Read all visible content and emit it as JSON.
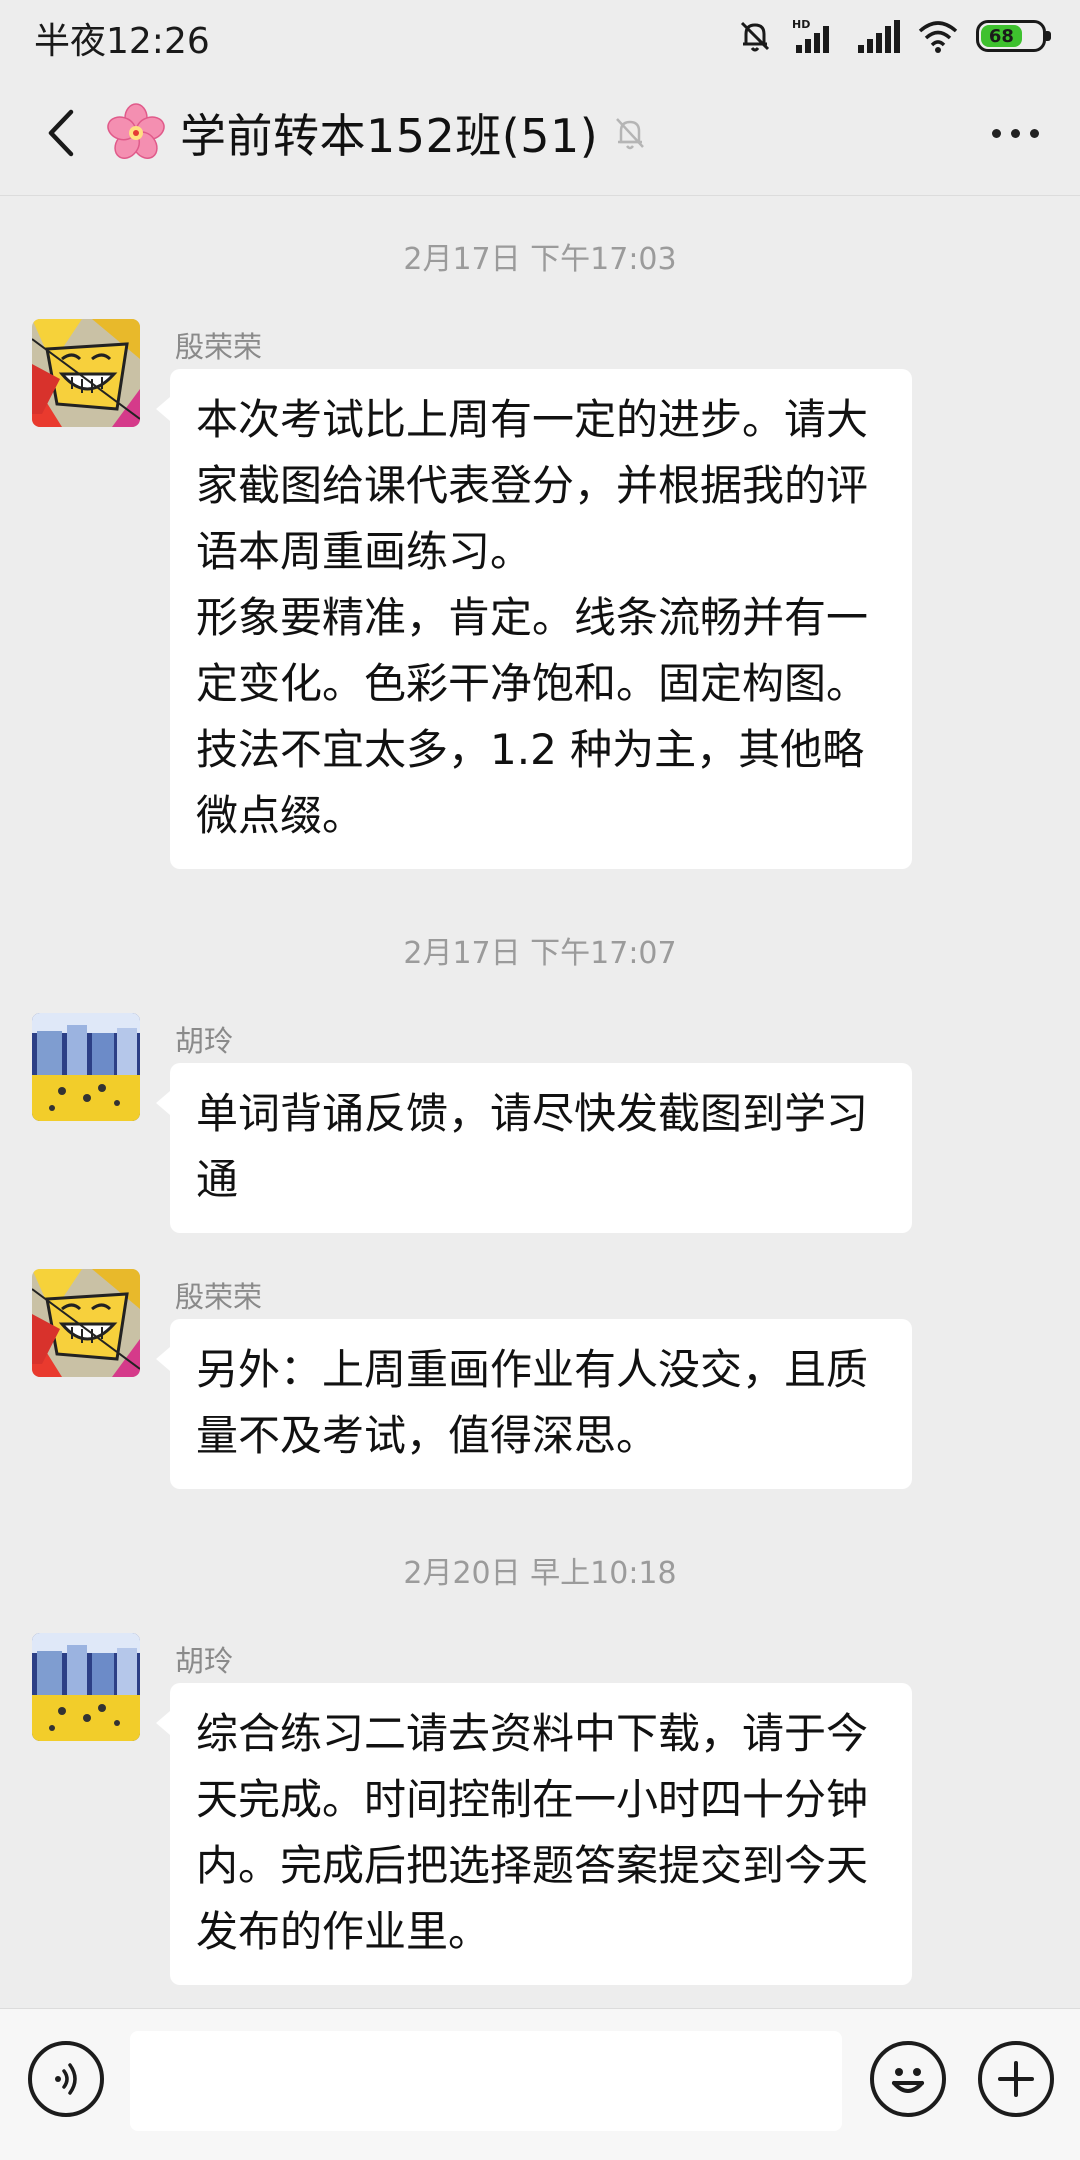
{
  "status_bar": {
    "time": "半夜12:26",
    "battery_level": "68",
    "icons": [
      "mute-bell-icon",
      "hd-signal-icon",
      "signal-icon",
      "wifi-icon",
      "battery-icon"
    ]
  },
  "header": {
    "title": "学前转本152班(51)",
    "group_icon": "cherry-blossom-icon",
    "muted_icon": "muted-bell-icon",
    "back_icon": "chevron-left-icon",
    "more_icon": "more-dots-icon"
  },
  "messages": [
    {
      "type": "timestamp",
      "text": "2月17日 下午17:03"
    },
    {
      "type": "message",
      "sender": "殷荣荣",
      "avatar": "smiling-sun-avatar",
      "text": "本次考试比上周有一定的进步。请大家截图给课代表登分，并根据我的评语本周重画练习。\n形象要精准，肯定。线条流畅并有一定变化。色彩干净饱和。固定构图。技法不宜太多，1.2 种为主，其他略微点缀。"
    },
    {
      "type": "timestamp",
      "text": "2月17日 下午17:07"
    },
    {
      "type": "message",
      "sender": "胡玲",
      "avatar": "city-painting-avatar",
      "text": "单词背诵反馈，请尽快发截图到学习通"
    },
    {
      "type": "message",
      "sender": "殷荣荣",
      "avatar": "smiling-sun-avatar",
      "text": "另外：上周重画作业有人没交，且质量不及考试，值得深思。"
    },
    {
      "type": "timestamp",
      "text": "2月20日 早上10:18"
    },
    {
      "type": "message",
      "sender": "胡玲",
      "avatar": "city-painting-avatar",
      "text": "综合练习二请去资料中下载，请于今天完成。时间控制在一小时四十分钟内。完成后把选择题答案提交到今天发布的作业里。"
    }
  ],
  "input_bar": {
    "value": "",
    "voice_icon": "voice-icon",
    "emoji_icon": "emoji-icon",
    "plus_icon": "plus-icon"
  }
}
